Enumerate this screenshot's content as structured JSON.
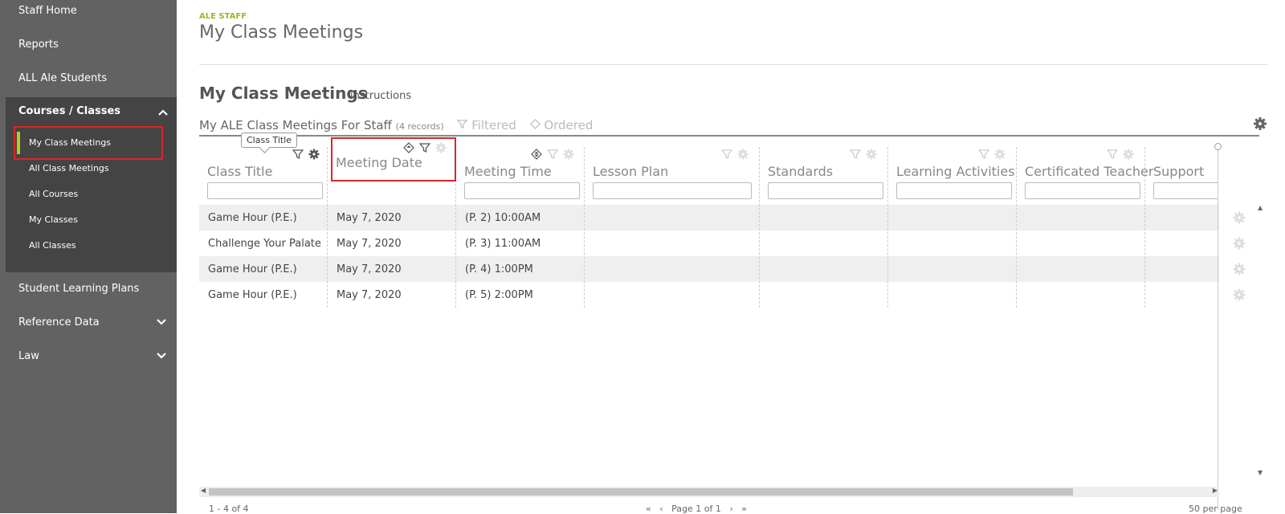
{
  "sidebar": {
    "top_items": [
      "Staff Home",
      "Reports",
      "ALL Ale Students"
    ],
    "group_title": "Courses / Classes",
    "group_items": [
      "My Class Meetings",
      "All Class Meetings",
      "All Courses",
      "My Classes",
      "All Classes"
    ],
    "bottom_items": [
      "Student Learning Plans",
      "Reference Data",
      "Law"
    ],
    "active_item": "My Class Meetings",
    "accent_color": "#b7cc1a",
    "highlight_color": "#d9262b"
  },
  "header": {
    "eyebrow": "ALE STAFF",
    "title": "My Class Meetings"
  },
  "section": {
    "title": "My Class Meetings",
    "instructions_link": "instructions"
  },
  "grid": {
    "caption": "My ALE Class Meetings For Staff",
    "record_count": "(4 records)",
    "filtered_label": "Filtered",
    "ordered_label": "Ordered",
    "tooltip": "Class Title",
    "columns": [
      "Class Title",
      "Meeting Date",
      "Meeting Time",
      "Lesson Plan",
      "Standards",
      "Learning Activities",
      "Certificated Teacher",
      "Support"
    ],
    "rows": [
      [
        "Game Hour (P.E.)",
        "May 7, 2020",
        "(P. 2) 10:00AM"
      ],
      [
        "Challenge Your Palate",
        "May 7, 2020",
        "(P. 3) 11:00AM"
      ],
      [
        "Game Hour (P.E.)",
        "May 7, 2020",
        "(P. 4) 1:00PM"
      ],
      [
        "Game Hour (P.E.)",
        "May 7, 2020",
        "(P. 5) 2:00PM"
      ]
    ]
  },
  "pager": {
    "range": "1 - 4 of 4",
    "page": "Page 1 of 1",
    "per_page": "50 per page"
  }
}
